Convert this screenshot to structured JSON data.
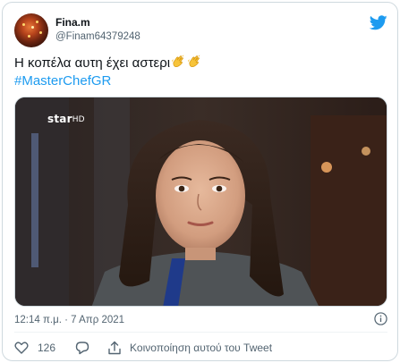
{
  "tweet": {
    "display_name": "Fina.m",
    "handle": "@Finam64379248",
    "text_line1": "Η κοπέλα αυτη έχει αστερι",
    "hashtag": "#MasterChefGR",
    "emoji": "clapping-hands-emoji",
    "timestamp": "12:14 π.μ. · 7 Απρ 2021"
  },
  "media": {
    "channel_logo": "star",
    "channel_logo_suffix": "HD"
  },
  "actions": {
    "like_count": "126",
    "share_label": "Κοινοποίηση αυτού του Tweet"
  },
  "icons": [
    "twitter-bird-icon",
    "heart-icon",
    "reply-icon",
    "share-icon",
    "info-icon"
  ],
  "colors": {
    "accent": "#1d9bf0",
    "secondary_text": "#536471",
    "border": "#cfd9de"
  }
}
